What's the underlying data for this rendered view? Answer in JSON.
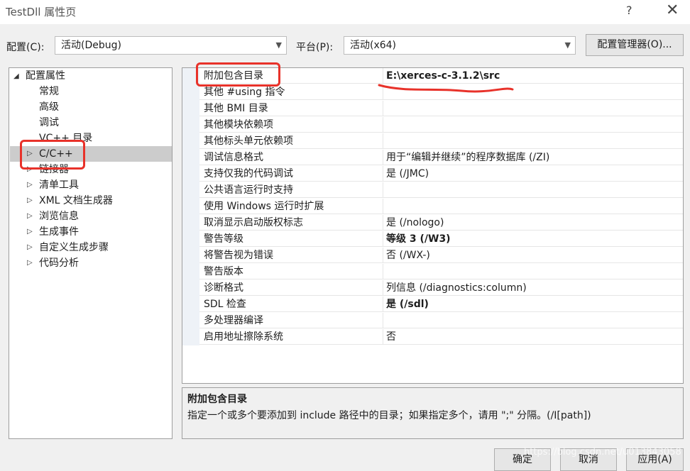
{
  "window": {
    "title": "TestDll 属性页",
    "help_glyph": "?",
    "close_glyph": "✕"
  },
  "config": {
    "config_label": "配置(C):",
    "config_value": "活动(Debug)",
    "platform_label": "平台(P):",
    "platform_value": "活动(x64)",
    "manager_button": "配置管理器(O)..."
  },
  "tree": {
    "root": "配置属性",
    "children": [
      "常规",
      "高级",
      "调试",
      "VC++ 目录"
    ],
    "groups": [
      "C/C++",
      "链接器",
      "清单工具",
      "XML 文档生成器",
      "浏览信息",
      "生成事件",
      "自定义生成步骤",
      "代码分析"
    ]
  },
  "properties": [
    {
      "name": "附加包含目录",
      "value": "E:\\xerces-c-3.1.2\\src",
      "bold": true
    },
    {
      "name": "其他 #using 指令",
      "value": "",
      "bold": false
    },
    {
      "name": "其他 BMI 目录",
      "value": "",
      "bold": false
    },
    {
      "name": "其他模块依赖项",
      "value": "",
      "bold": false
    },
    {
      "name": "其他标头单元依赖项",
      "value": "",
      "bold": false
    },
    {
      "name": "调试信息格式",
      "value": "用于“编辑并继续”的程序数据库 (/ZI)",
      "bold": false
    },
    {
      "name": "支持仅我的代码调试",
      "value": "是 (/JMC)",
      "bold": false
    },
    {
      "name": "公共语言运行时支持",
      "value": "",
      "bold": false
    },
    {
      "name": "使用 Windows 运行时扩展",
      "value": "",
      "bold": false
    },
    {
      "name": "取消显示启动版权标志",
      "value": "是 (/nologo)",
      "bold": false
    },
    {
      "name": "警告等级",
      "value": "等级 3 (/W3)",
      "bold": true
    },
    {
      "name": "将警告视为错误",
      "value": "否 (/WX-)",
      "bold": false
    },
    {
      "name": "警告版本",
      "value": "",
      "bold": false
    },
    {
      "name": "诊断格式",
      "value": "列信息 (/diagnostics:column)",
      "bold": false
    },
    {
      "name": "SDL 检查",
      "value": "是 (/sdl)",
      "bold": true
    },
    {
      "name": "多处理器编译",
      "value": "",
      "bold": false
    },
    {
      "name": "启用地址擦除系统",
      "value": "否",
      "bold": false
    }
  ],
  "description": {
    "title": "附加包含目录",
    "text": "指定一个或多个要添加到 include 路径中的目录；如果指定多个，请用 \";\" 分隔。(/I[path])"
  },
  "buttons": {
    "ok": "确定",
    "cancel": "取消",
    "apply": "应用(A)"
  },
  "watermark": "https://blog.csdn.net/u013843058",
  "colors": {
    "annotation_red": "#e8322a",
    "selection_gray": "#cccccc"
  }
}
